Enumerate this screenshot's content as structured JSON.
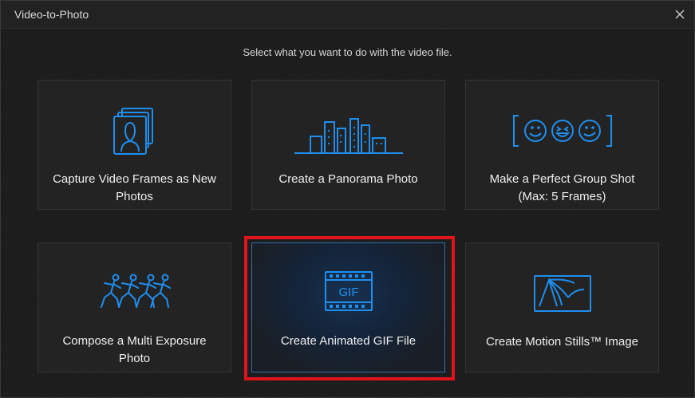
{
  "window": {
    "title": "Video-to-Photo",
    "close_icon": "close-icon"
  },
  "instruction": "Select what you want to do with the video file.",
  "accent_color": "#1e8ff0",
  "highlight_color": "#e0141c",
  "cards": [
    {
      "label_line1": "Capture Video Frames as New",
      "label_line2": "Photos",
      "icon": "portrait-frames-icon"
    },
    {
      "label_line1": "Create a Panorama Photo",
      "label_line2": "",
      "icon": "city-skyline-icon"
    },
    {
      "label_line1": "Make a Perfect Group Shot",
      "label_line2": "(Max: 5 Frames)",
      "icon": "smiley-faces-icon"
    },
    {
      "label_line1": "Compose a Multi Exposure",
      "label_line2": "Photo",
      "icon": "running-figures-icon"
    },
    {
      "label_line1": "Create Animated GIF File",
      "label_line2": "",
      "icon": "gif-film-icon",
      "icon_text": "GIF",
      "selected": true
    },
    {
      "label_line1": "Create Motion Stills™ Image",
      "label_line2": "",
      "icon": "motion-stills-icon"
    }
  ]
}
